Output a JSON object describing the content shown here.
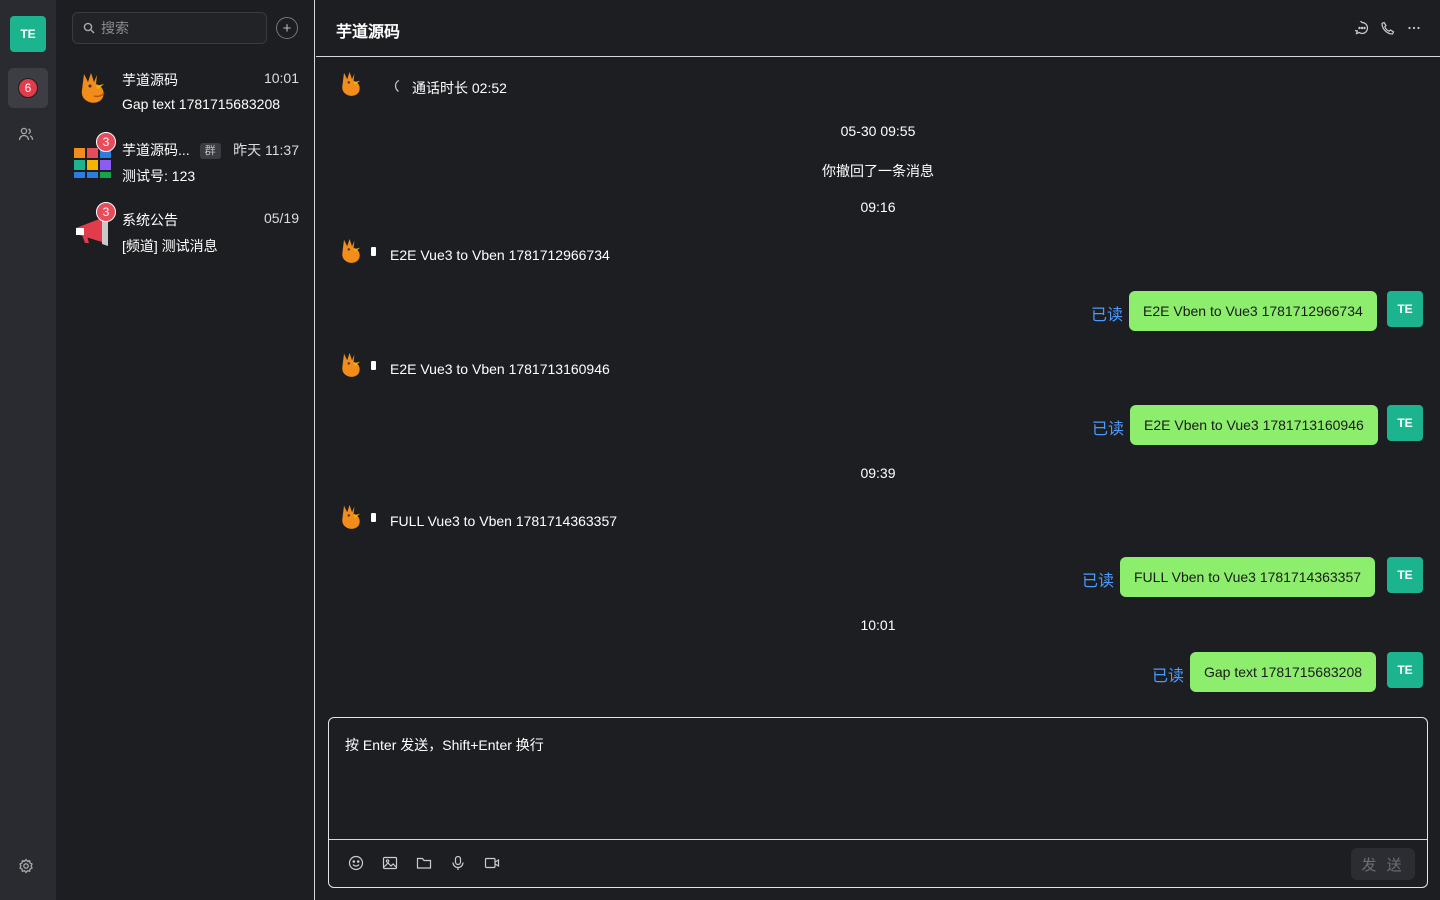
{
  "rail": {
    "avatar_label": "TE",
    "chat_badge": "6"
  },
  "search": {
    "placeholder": "搜索"
  },
  "add_label": "+",
  "conversations": [
    {
      "name": "芋道源码",
      "time": "10:01",
      "preview": "Gap text 1781715683208"
    },
    {
      "name": "芋道源码...",
      "tag": "群",
      "time": "昨天 11:37",
      "preview": "测试号: 123",
      "badge": "3"
    },
    {
      "name": "系统公告",
      "time": "05/19",
      "preview": "[频道] 测试消息",
      "badge": "3"
    }
  ],
  "header": {
    "title": "芋道源码"
  },
  "messages": {
    "call": "通话时长 02:52",
    "ts1": "05-30 09:55",
    "recall": "你撤回了一条消息",
    "ts2": "09:16",
    "in1": "E2E Vue3 to Vben 1781712966734",
    "out1": "E2E Vben to Vue3 1781712966734",
    "in2": "E2E Vue3 to Vben 1781713160946",
    "out2": "E2E Vben to Vue3 1781713160946",
    "ts3": "09:39",
    "in3": "FULL Vue3 to Vben 1781714363357",
    "out3": "FULL Vben to Vue3 1781714363357",
    "ts4": "10:01",
    "out4": "Gap text 1781715683208",
    "read": "已读",
    "me": "TE"
  },
  "composer": {
    "placeholder": "按 Enter 发送，Shift+Enter 换行",
    "send": "发 送"
  },
  "colors": {
    "accent": "#1bb48e",
    "bubble": "#8ded6d",
    "read": "#4c9bff",
    "badge": "#e74c5a"
  }
}
